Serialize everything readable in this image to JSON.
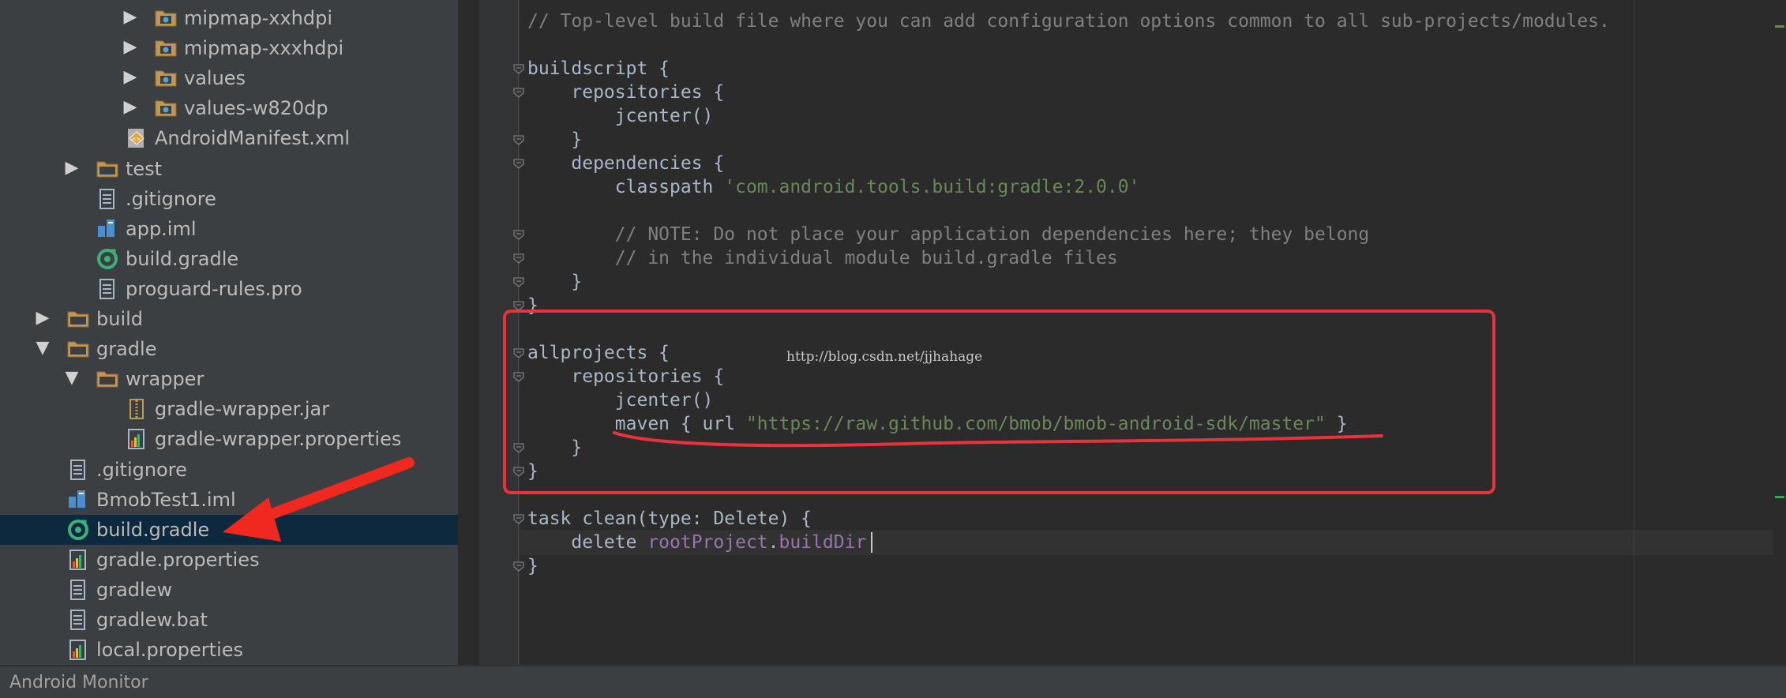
{
  "project_tree": {
    "items": [
      {
        "label": "mipmap-xxhdpi",
        "icon": "resource-folder-icon",
        "arrow": "collapsed"
      },
      {
        "label": "mipmap-xxxhdpi",
        "icon": "resource-folder-icon",
        "arrow": "collapsed"
      },
      {
        "label": "values",
        "icon": "resource-folder-icon",
        "arrow": "collapsed"
      },
      {
        "label": "values-w820dp",
        "icon": "resource-folder-icon",
        "arrow": "collapsed"
      },
      {
        "label": "AndroidManifest.xml",
        "icon": "xml-manifest-icon",
        "arrow": "none"
      },
      {
        "label": "test",
        "icon": "folder-icon",
        "arrow": "collapsed"
      },
      {
        "label": ".gitignore",
        "icon": "text-file-icon",
        "arrow": "none"
      },
      {
        "label": "app.iml",
        "icon": "iml-module-icon",
        "arrow": "none"
      },
      {
        "label": "build.gradle",
        "icon": "gradle-icon",
        "arrow": "none"
      },
      {
        "label": "proguard-rules.pro",
        "icon": "text-file-icon",
        "arrow": "none"
      },
      {
        "label": "build",
        "icon": "folder-icon",
        "arrow": "collapsed"
      },
      {
        "label": "gradle",
        "icon": "folder-icon",
        "arrow": "expanded"
      },
      {
        "label": "wrapper",
        "icon": "folder-icon",
        "arrow": "expanded"
      },
      {
        "label": "gradle-wrapper.jar",
        "icon": "jar-archive-icon",
        "arrow": "none"
      },
      {
        "label": "gradle-wrapper.properties",
        "icon": "properties-file-icon",
        "arrow": "none"
      },
      {
        "label": ".gitignore",
        "icon": "text-file-icon",
        "arrow": "none"
      },
      {
        "label": "BmobTest1.iml",
        "icon": "iml-module-icon",
        "arrow": "none"
      },
      {
        "label": "build.gradle",
        "icon": "gradle-icon",
        "arrow": "none",
        "selected": true
      },
      {
        "label": "gradle.properties",
        "icon": "properties-file-icon",
        "arrow": "none"
      },
      {
        "label": "gradlew",
        "icon": "text-file-icon",
        "arrow": "none"
      },
      {
        "label": "gradlew.bat",
        "icon": "text-file-icon",
        "arrow": "none"
      },
      {
        "label": "local.properties",
        "icon": "properties-file-icon",
        "arrow": "none"
      }
    ]
  },
  "editor": {
    "lines": [
      [
        {
          "t": "// Top-level build file where you can add configuration options common to all sub-projects/modules.",
          "c": "cm"
        }
      ],
      [],
      [
        {
          "t": "buildscript {",
          "c": "kw"
        }
      ],
      [
        {
          "t": "    repositories {",
          "c": "kw"
        }
      ],
      [
        {
          "t": "        jcenter()",
          "c": "kw"
        }
      ],
      [
        {
          "t": "    }",
          "c": "kw"
        }
      ],
      [
        {
          "t": "    dependencies {",
          "c": "kw"
        }
      ],
      [
        {
          "t": "        classpath ",
          "c": "kw"
        },
        {
          "t": "'com.android.tools.build:gradle:2.0.0'",
          "c": "str"
        }
      ],
      [],
      [
        {
          "t": "        // NOTE: Do not place your application dependencies here; they belong",
          "c": "cm"
        }
      ],
      [
        {
          "t": "        // in the individual module build.gradle files",
          "c": "cm"
        }
      ],
      [
        {
          "t": "    }",
          "c": "kw"
        }
      ],
      [
        {
          "t": "}",
          "c": "kw"
        }
      ],
      [],
      [
        {
          "t": "allprojects {",
          "c": "kw"
        }
      ],
      [
        {
          "t": "    repositories {",
          "c": "kw"
        }
      ],
      [
        {
          "t": "        jcenter()",
          "c": "kw"
        }
      ],
      [
        {
          "t": "        maven { url ",
          "c": "kw"
        },
        {
          "t": "\"https://raw.github.com/bmob/bmob-android-sdk/master\"",
          "c": "str"
        },
        {
          "t": " }",
          "c": "kw"
        }
      ],
      [
        {
          "t": "    }",
          "c": "kw"
        }
      ],
      [
        {
          "t": "}",
          "c": "kw"
        }
      ],
      [],
      [
        {
          "t": "task clean(type: Delete) {",
          "c": "kw"
        }
      ],
      [
        {
          "t": "    delete ",
          "c": "kw"
        },
        {
          "t": "rootProject",
          "c": "fld"
        },
        {
          "t": ".",
          "c": "kw"
        },
        {
          "t": "buildDir",
          "c": "fld"
        }
      ],
      [
        {
          "t": "}",
          "c": "kw"
        }
      ]
    ],
    "watermark": "http://blog.csdn.net/jjhahage"
  },
  "bottom_bar": {
    "label": "Android Monitor"
  },
  "colors": {
    "annotation_red": "#e8323c",
    "selection": "#0d293e",
    "string_green": "#6a8759",
    "comment_gray": "#808080"
  }
}
